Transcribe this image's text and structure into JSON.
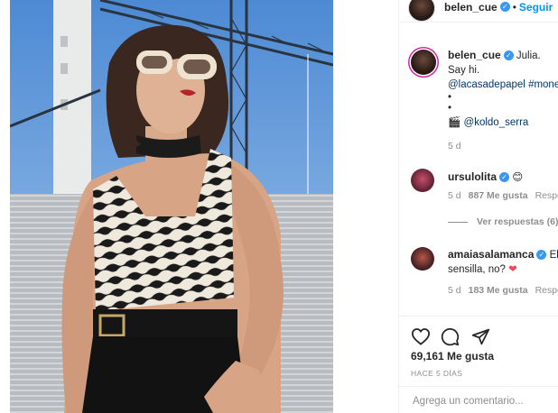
{
  "post": {
    "author": "belen_cue",
    "follow_label": "Seguir",
    "dot_separator": "•"
  },
  "caption": {
    "username": "belen_cue",
    "text_line1": "Julia.",
    "text_line2": "Say hi.",
    "mention": "@lacasadepapel",
    "hashtag": "#mone",
    "bullet1": "•",
    "bullet2": "•",
    "clapper": "🎬",
    "credit": "@koldo_serra",
    "time": "5 d"
  },
  "comments": [
    {
      "username": "ursulolita",
      "text": "😊",
      "time": "5 d",
      "likes": "887 Me gusta",
      "reply": "Respo",
      "view_replies": "Ver respuestas (6)"
    },
    {
      "username": "amaiasalamanca",
      "text_inline": "Ella",
      "text_line2": "sensilla, no?",
      "heart": "❤",
      "time": "5 d",
      "likes": "183 Me gusta",
      "reply": "Respo"
    }
  ],
  "icons": [
    "heart-icon",
    "comment-icon",
    "share-icon"
  ],
  "likes_total": "69,161 Me gusta",
  "posted_ago": "HACE 5 DÍAS",
  "comment_input": {
    "placeholder": "Agrega un comentario..."
  },
  "colors": {
    "accent": "#0095f6",
    "verified": "#3897f0",
    "text": "#262626",
    "muted": "#8e8e8e"
  }
}
